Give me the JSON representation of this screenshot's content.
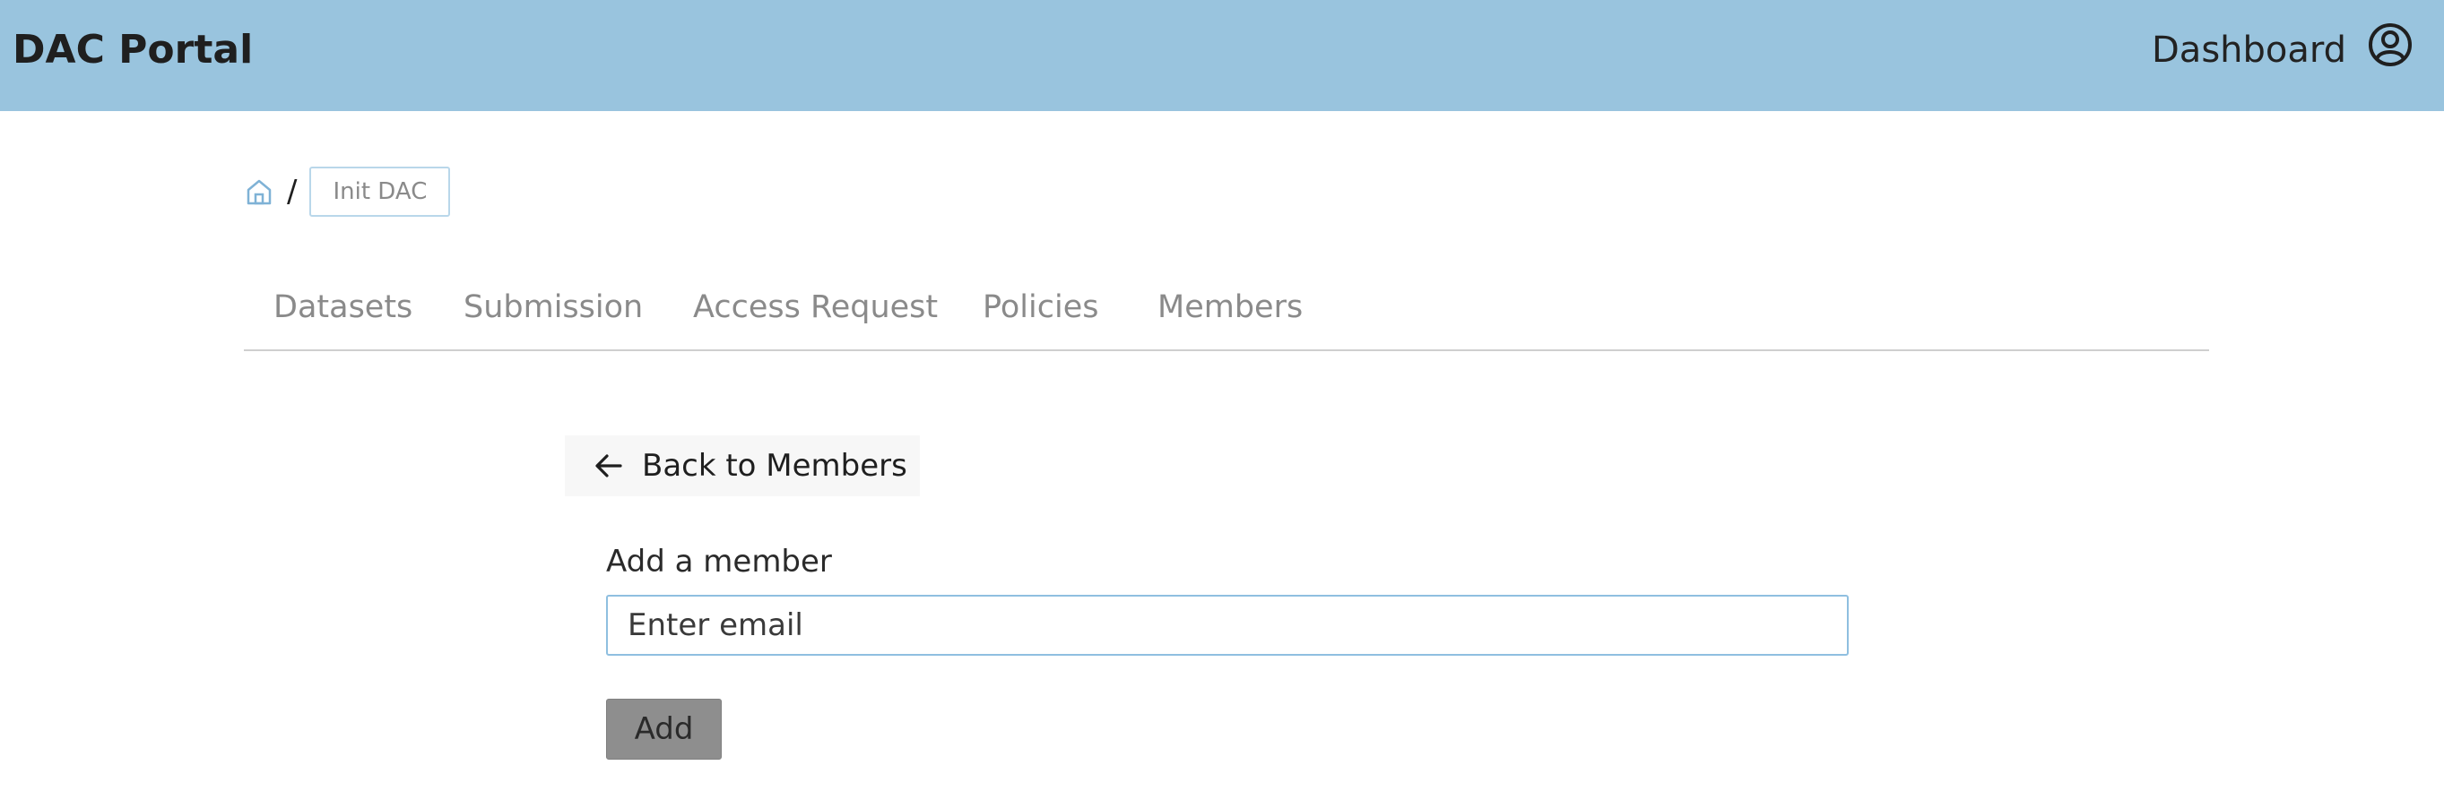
{
  "header": {
    "brand": "DAC Portal",
    "dashboard_label": "Dashboard",
    "user_icon": "user-circle-icon",
    "background_color": "#99c4de"
  },
  "breadcrumb": {
    "home_icon": "home-icon",
    "separator": "/",
    "current": "Init DAC"
  },
  "tabs": [
    {
      "label": "Datasets"
    },
    {
      "label": "Submission"
    },
    {
      "label": "Access Request"
    },
    {
      "label": "Policies"
    },
    {
      "label": "Members"
    }
  ],
  "back": {
    "icon": "arrow-left-icon",
    "label": "Back to Members"
  },
  "form": {
    "label": "Add a member",
    "email_placeholder": "Enter email",
    "email_value": "",
    "submit_label": "Add"
  }
}
